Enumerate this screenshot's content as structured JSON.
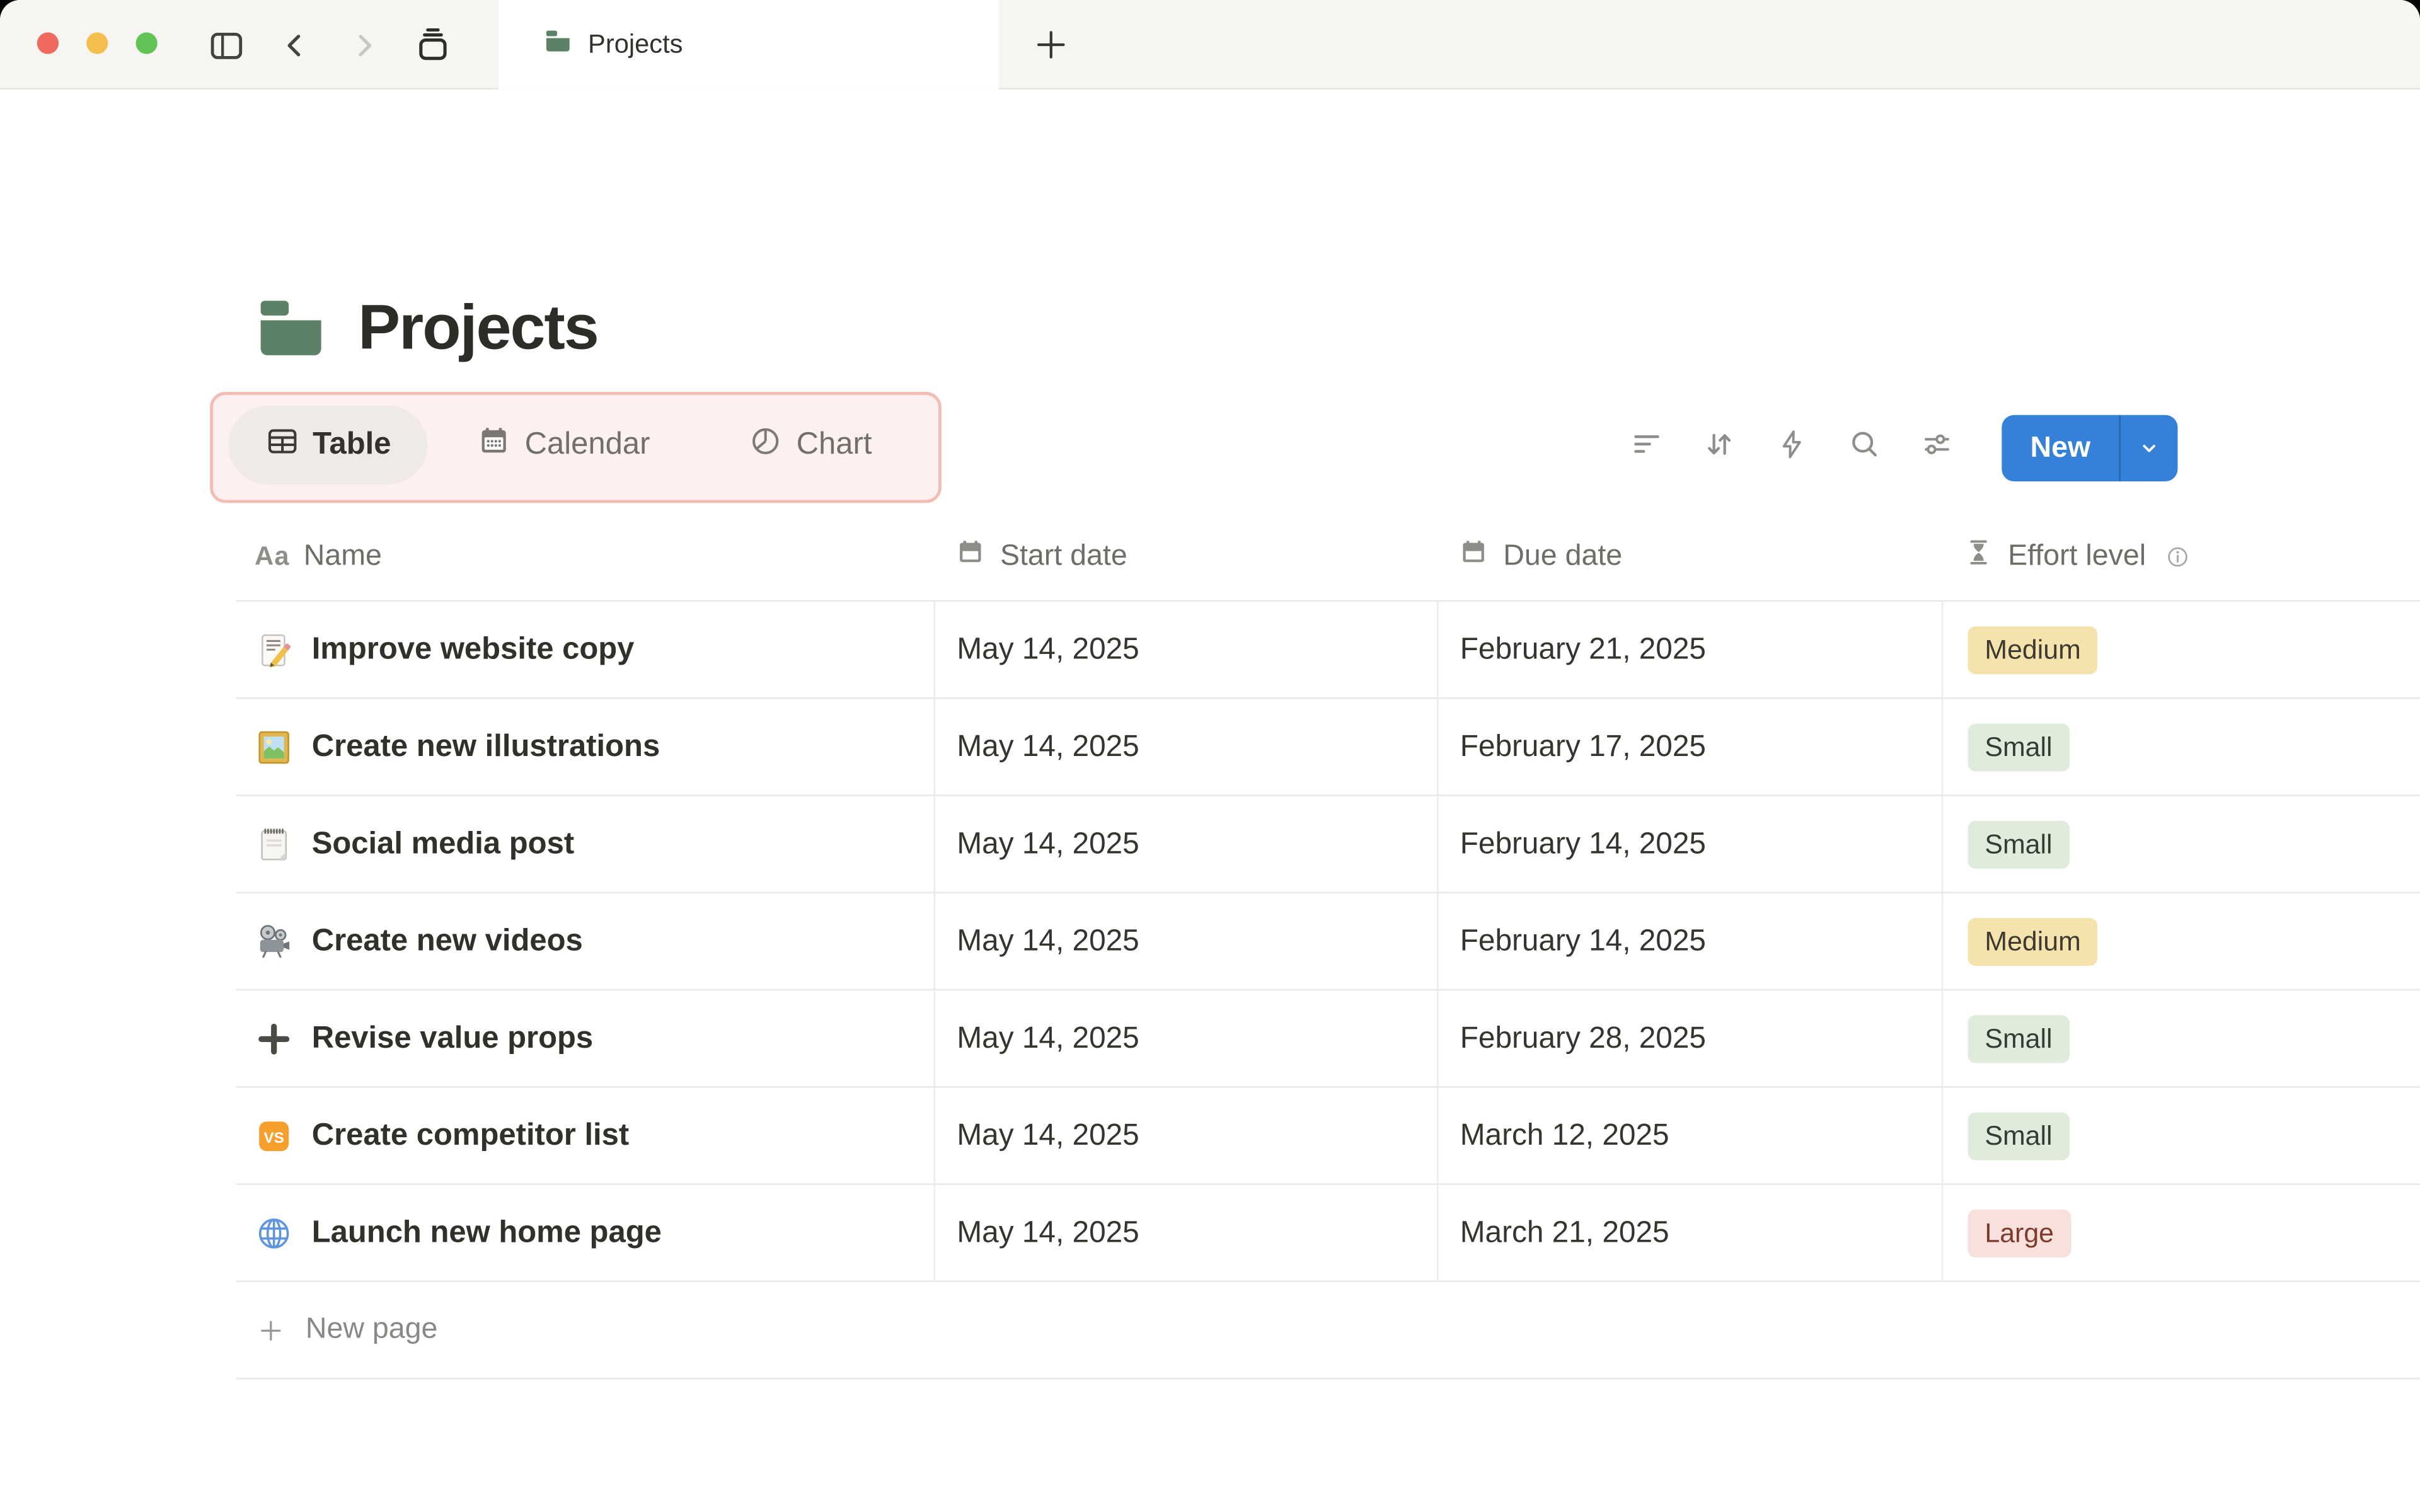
{
  "window": {
    "tab": {
      "title": "Projects"
    },
    "controls": {
      "close_color": "#ee6a5f",
      "minimize_color": "#f5bf4f",
      "zoom_color": "#61c454"
    }
  },
  "page": {
    "title": "Projects"
  },
  "views": [
    {
      "label": "Table",
      "active": true
    },
    {
      "label": "Calendar",
      "active": false
    },
    {
      "label": "Chart",
      "active": false
    }
  ],
  "toolbar": {
    "new_label": "New"
  },
  "icons": {
    "vs_label": "VS",
    "name_type_icon": "Aa"
  },
  "table": {
    "headers": {
      "name": "Name",
      "start": "Start date",
      "due": "Due date",
      "effort": "Effort level"
    },
    "rows": [
      {
        "icon": "memo-icon",
        "name": "Improve website copy",
        "start": "May 14, 2025",
        "due": "February 21, 2025",
        "effort": "Medium",
        "effort_class": "badge-yellow"
      },
      {
        "icon": "framed-picture-icon",
        "name": "Create new illustrations",
        "start": "May 14, 2025",
        "due": "February 17, 2025",
        "effort": "Small",
        "effort_class": "badge-green"
      },
      {
        "icon": "notepad-icon",
        "name": "Social media post",
        "start": "May 14, 2025",
        "due": "February 14, 2025",
        "effort": "Small",
        "effort_class": "badge-green"
      },
      {
        "icon": "film-projector-icon",
        "name": "Create new videos",
        "start": "May 14, 2025",
        "due": "February 14, 2025",
        "effort": "Medium",
        "effort_class": "badge-yellow"
      },
      {
        "icon": "plus-icon",
        "name": "Revise value props",
        "start": "May 14, 2025",
        "due": "February 28, 2025",
        "effort": "Small",
        "effort_class": "badge-green"
      },
      {
        "icon": "vs-icon",
        "name": "Create competitor list",
        "start": "May 14, 2025",
        "due": "March 12, 2025",
        "effort": "Small",
        "effort_class": "badge-green"
      },
      {
        "icon": "globe-icon",
        "name": "Launch new home page",
        "start": "May 14, 2025",
        "due": "March 21, 2025",
        "effort": "Large",
        "effort_class": "badge-red"
      }
    ],
    "footer": {
      "new_page_label": "New page"
    }
  },
  "colors": {
    "accent_blue": "#3580d9",
    "folder_green": "#5d8166",
    "highlight_border": "#f3bdb5",
    "highlight_bg": "#fdf1ef",
    "badge_yellow_bg": "#f5e3ad",
    "badge_green_bg": "#dfecdc",
    "badge_red_bg": "#f8e0dc"
  }
}
